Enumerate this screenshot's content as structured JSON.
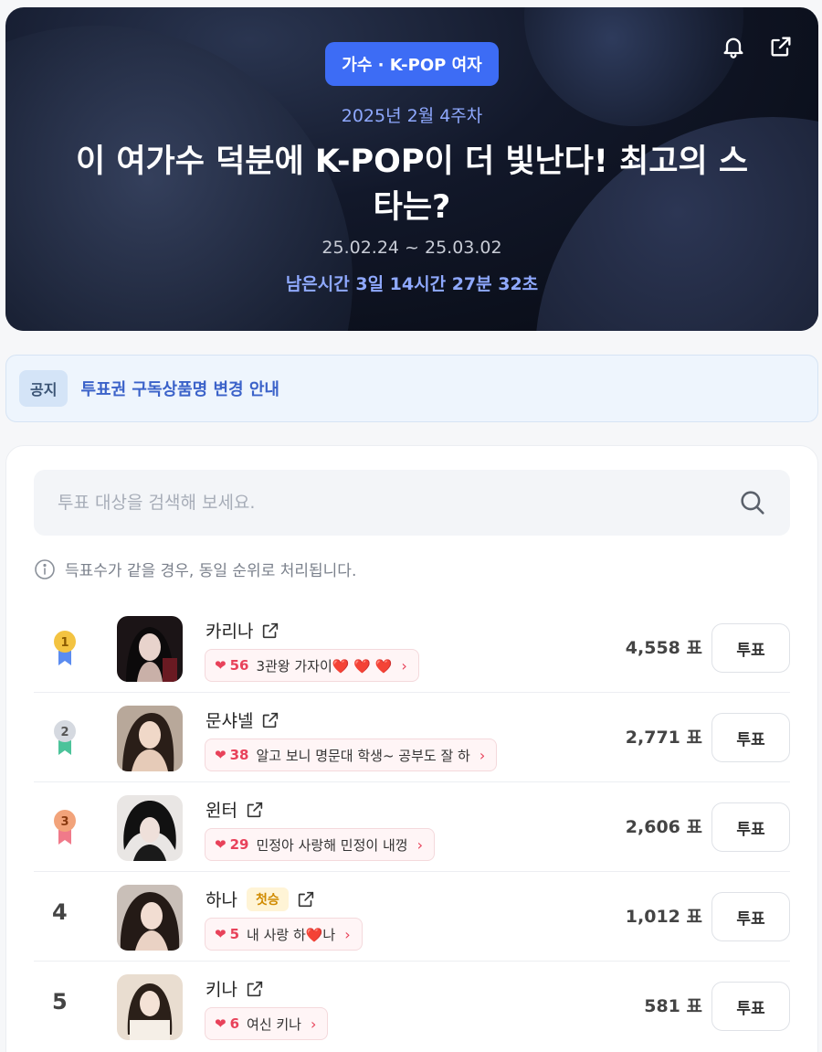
{
  "hero": {
    "category_badge": "가수 · K-POP 여자",
    "week_label": "2025년 2월 4주차",
    "title": "이 여가수 덕분에 K-POP이 더 빛난다! 최고의 스타는?",
    "period": "25.02.24 ~ 25.03.02",
    "remaining": "남은시간 3일 14시간 27분 32초",
    "icons": [
      "bell-icon",
      "share-icon"
    ]
  },
  "notice": {
    "tag": "공지",
    "text": "투표권 구독상품명 변경 안내"
  },
  "search": {
    "placeholder": "투표 대상을 검색해 보세요.",
    "icon": "search-icon"
  },
  "info_text": "득표수가 같을 경우, 동일 순위로 처리됩니다.",
  "colors": {
    "accent": "#3d6cf5",
    "cheer_red": "#e8425a",
    "gold": "#f3c341",
    "silver": "#c9ced6",
    "bronze": "#f2a37a"
  },
  "rankings": [
    {
      "rank": "1",
      "name": "카리나",
      "badge": "",
      "cheer_count": "56",
      "cheer_text": "3관왕 가자이❤️ ❤️ ❤️",
      "votes": "4,558 표",
      "vote_label": "투표"
    },
    {
      "rank": "2",
      "name": "문샤넬",
      "badge": "",
      "cheer_count": "38",
      "cheer_text": "알고 보니 명문대 학생~ 공부도 잘 하",
      "votes": "2,771 표",
      "vote_label": "투표"
    },
    {
      "rank": "3",
      "name": "윈터",
      "badge": "",
      "cheer_count": "29",
      "cheer_text": "민정아 사랑해 민정이 내껑",
      "votes": "2,606 표",
      "vote_label": "투표"
    },
    {
      "rank": "4",
      "name": "하나",
      "badge": "첫승",
      "cheer_count": "5",
      "cheer_text": "내 사랑 하❤️나",
      "votes": "1,012 표",
      "vote_label": "투표"
    },
    {
      "rank": "5",
      "name": "키나",
      "badge": "",
      "cheer_count": "6",
      "cheer_text": "여신 키나",
      "votes": "581 표",
      "vote_label": "투표"
    }
  ]
}
